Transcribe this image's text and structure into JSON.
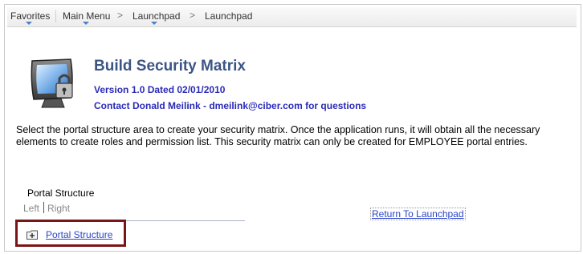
{
  "navbar": {
    "favorites": "Favorites",
    "main_menu": "Main Menu",
    "launchpad_1": "Launchpad",
    "launchpad_2": "Launchpad",
    "chevron": ">"
  },
  "header": {
    "title": "Build Security Matrix",
    "version": "Version 1.0 Dated 02/01/2010",
    "contact": "Contact Donald Meilink - dmeilink@ciber.com for questions"
  },
  "description": "Select the portal structure area to create your security matrix. Once the application runs, it will obtain all the necessary elements to create roles and permission list. This security matrix can only be created for EMPLOYEE portal entries.",
  "portal": {
    "label": "Portal Structure",
    "left": "Left",
    "right": "Right",
    "tree_item": "Portal Structure"
  },
  "links": {
    "return": "Return To Launchpad"
  },
  "colors": {
    "title": "#3c5585",
    "info_text": "#2a2ab8",
    "link": "#2b44c8",
    "highlight_border": "#7b1416",
    "nav_arrow": "#4a80c8"
  },
  "icons": {
    "app": "secure-monitor-icon",
    "folder": "folder-plus-icon"
  }
}
